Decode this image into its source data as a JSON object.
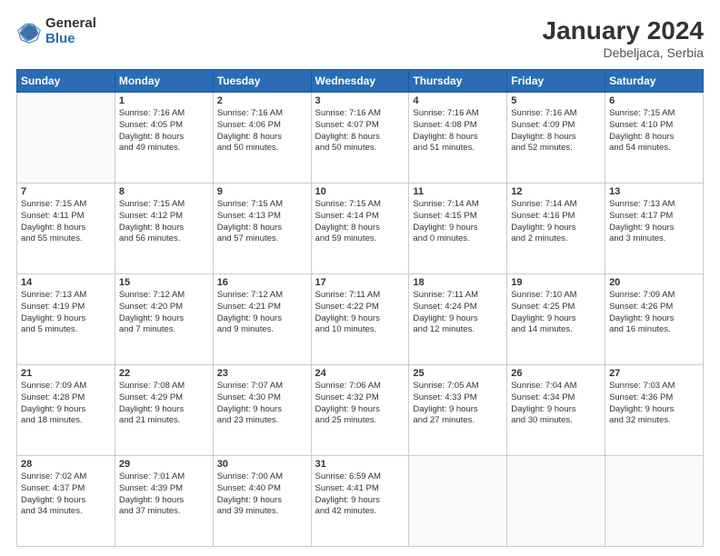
{
  "header": {
    "logo_general": "General",
    "logo_blue": "Blue",
    "month_title": "January 2024",
    "location": "Debeljaca, Serbia"
  },
  "days_of_week": [
    "Sunday",
    "Monday",
    "Tuesday",
    "Wednesday",
    "Thursday",
    "Friday",
    "Saturday"
  ],
  "weeks": [
    [
      {
        "num": "",
        "info": ""
      },
      {
        "num": "1",
        "info": "Sunrise: 7:16 AM\nSunset: 4:05 PM\nDaylight: 8 hours\nand 49 minutes."
      },
      {
        "num": "2",
        "info": "Sunrise: 7:16 AM\nSunset: 4:06 PM\nDaylight: 8 hours\nand 50 minutes."
      },
      {
        "num": "3",
        "info": "Sunrise: 7:16 AM\nSunset: 4:07 PM\nDaylight: 8 hours\nand 50 minutes."
      },
      {
        "num": "4",
        "info": "Sunrise: 7:16 AM\nSunset: 4:08 PM\nDaylight: 8 hours\nand 51 minutes."
      },
      {
        "num": "5",
        "info": "Sunrise: 7:16 AM\nSunset: 4:09 PM\nDaylight: 8 hours\nand 52 minutes."
      },
      {
        "num": "6",
        "info": "Sunrise: 7:15 AM\nSunset: 4:10 PM\nDaylight: 8 hours\nand 54 minutes."
      }
    ],
    [
      {
        "num": "7",
        "info": "Sunrise: 7:15 AM\nSunset: 4:11 PM\nDaylight: 8 hours\nand 55 minutes."
      },
      {
        "num": "8",
        "info": "Sunrise: 7:15 AM\nSunset: 4:12 PM\nDaylight: 8 hours\nand 56 minutes."
      },
      {
        "num": "9",
        "info": "Sunrise: 7:15 AM\nSunset: 4:13 PM\nDaylight: 8 hours\nand 57 minutes."
      },
      {
        "num": "10",
        "info": "Sunrise: 7:15 AM\nSunset: 4:14 PM\nDaylight: 8 hours\nand 59 minutes."
      },
      {
        "num": "11",
        "info": "Sunrise: 7:14 AM\nSunset: 4:15 PM\nDaylight: 9 hours\nand 0 minutes."
      },
      {
        "num": "12",
        "info": "Sunrise: 7:14 AM\nSunset: 4:16 PM\nDaylight: 9 hours\nand 2 minutes."
      },
      {
        "num": "13",
        "info": "Sunrise: 7:13 AM\nSunset: 4:17 PM\nDaylight: 9 hours\nand 3 minutes."
      }
    ],
    [
      {
        "num": "14",
        "info": "Sunrise: 7:13 AM\nSunset: 4:19 PM\nDaylight: 9 hours\nand 5 minutes."
      },
      {
        "num": "15",
        "info": "Sunrise: 7:12 AM\nSunset: 4:20 PM\nDaylight: 9 hours\nand 7 minutes."
      },
      {
        "num": "16",
        "info": "Sunrise: 7:12 AM\nSunset: 4:21 PM\nDaylight: 9 hours\nand 9 minutes."
      },
      {
        "num": "17",
        "info": "Sunrise: 7:11 AM\nSunset: 4:22 PM\nDaylight: 9 hours\nand 10 minutes."
      },
      {
        "num": "18",
        "info": "Sunrise: 7:11 AM\nSunset: 4:24 PM\nDaylight: 9 hours\nand 12 minutes."
      },
      {
        "num": "19",
        "info": "Sunrise: 7:10 AM\nSunset: 4:25 PM\nDaylight: 9 hours\nand 14 minutes."
      },
      {
        "num": "20",
        "info": "Sunrise: 7:09 AM\nSunset: 4:26 PM\nDaylight: 9 hours\nand 16 minutes."
      }
    ],
    [
      {
        "num": "21",
        "info": "Sunrise: 7:09 AM\nSunset: 4:28 PM\nDaylight: 9 hours\nand 18 minutes."
      },
      {
        "num": "22",
        "info": "Sunrise: 7:08 AM\nSunset: 4:29 PM\nDaylight: 9 hours\nand 21 minutes."
      },
      {
        "num": "23",
        "info": "Sunrise: 7:07 AM\nSunset: 4:30 PM\nDaylight: 9 hours\nand 23 minutes."
      },
      {
        "num": "24",
        "info": "Sunrise: 7:06 AM\nSunset: 4:32 PM\nDaylight: 9 hours\nand 25 minutes."
      },
      {
        "num": "25",
        "info": "Sunrise: 7:05 AM\nSunset: 4:33 PM\nDaylight: 9 hours\nand 27 minutes."
      },
      {
        "num": "26",
        "info": "Sunrise: 7:04 AM\nSunset: 4:34 PM\nDaylight: 9 hours\nand 30 minutes."
      },
      {
        "num": "27",
        "info": "Sunrise: 7:03 AM\nSunset: 4:36 PM\nDaylight: 9 hours\nand 32 minutes."
      }
    ],
    [
      {
        "num": "28",
        "info": "Sunrise: 7:02 AM\nSunset: 4:37 PM\nDaylight: 9 hours\nand 34 minutes."
      },
      {
        "num": "29",
        "info": "Sunrise: 7:01 AM\nSunset: 4:39 PM\nDaylight: 9 hours\nand 37 minutes."
      },
      {
        "num": "30",
        "info": "Sunrise: 7:00 AM\nSunset: 4:40 PM\nDaylight: 9 hours\nand 39 minutes."
      },
      {
        "num": "31",
        "info": "Sunrise: 6:59 AM\nSunset: 4:41 PM\nDaylight: 9 hours\nand 42 minutes."
      },
      {
        "num": "",
        "info": ""
      },
      {
        "num": "",
        "info": ""
      },
      {
        "num": "",
        "info": ""
      }
    ]
  ]
}
